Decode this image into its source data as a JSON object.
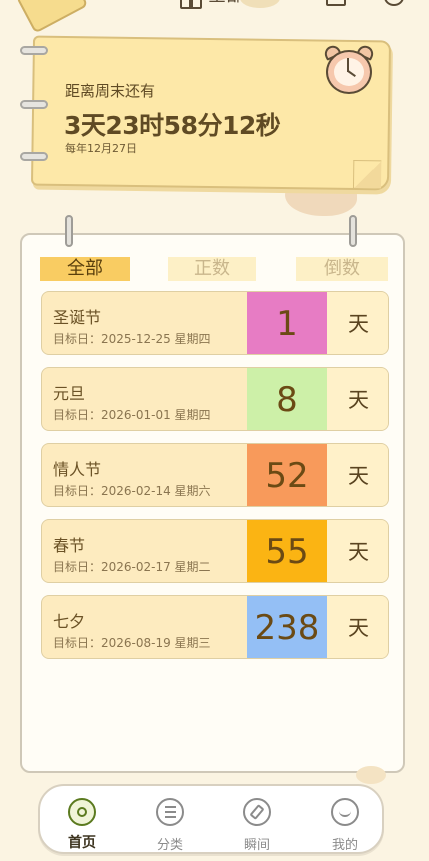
{
  "header": {
    "filter_label": "全部"
  },
  "countdown": {
    "title": "距离周末还有",
    "value": "3天23时58分12秒",
    "subtitle": "每年12月27日"
  },
  "tabs": [
    {
      "label": "全部",
      "active": true
    },
    {
      "label": "正数",
      "active": false
    },
    {
      "label": "倒数",
      "active": false
    }
  ],
  "events": [
    {
      "name": "圣诞节",
      "date": "目标日：2025-12-25 星期四",
      "days": "1",
      "unit": "天",
      "color": "#e77cc4"
    },
    {
      "name": "元旦",
      "date": "目标日：2026-01-01 星期四",
      "days": "8",
      "unit": "天",
      "color": "#cdf0a8"
    },
    {
      "name": "情人节",
      "date": "目标日：2026-02-14 星期六",
      "days": "52",
      "unit": "天",
      "color": "#f89a5b"
    },
    {
      "name": "春节",
      "date": "目标日：2026-02-17 星期二",
      "days": "55",
      "unit": "天",
      "color": "#fbb413"
    },
    {
      "name": "七夕",
      "date": "目标日：2026-08-19 星期三",
      "days": "238",
      "unit": "天",
      "color": "#94bff5"
    }
  ],
  "nav": [
    {
      "label": "首页",
      "icon": "home-icon",
      "active": true
    },
    {
      "label": "分类",
      "icon": "list-icon",
      "active": false
    },
    {
      "label": "瞬间",
      "icon": "compass-icon",
      "active": false
    },
    {
      "label": "我的",
      "icon": "smiley-icon",
      "active": false
    }
  ]
}
